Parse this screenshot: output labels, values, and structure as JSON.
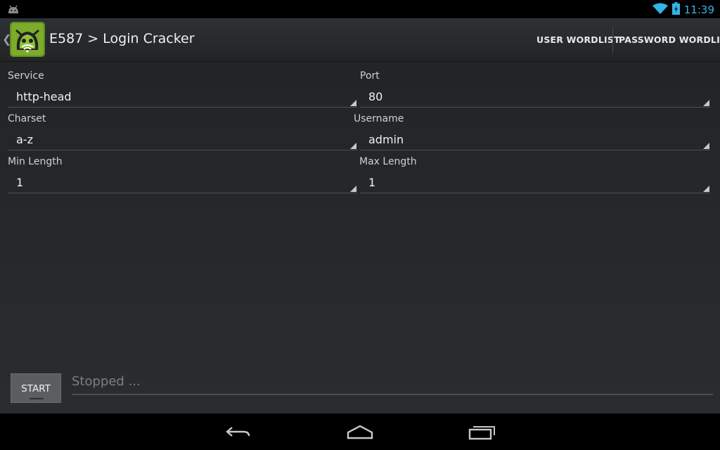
{
  "status_bar": {
    "time": "11:39",
    "icons": [
      "android-icon",
      "wifi-icon",
      "battery-charging-icon"
    ]
  },
  "action_bar": {
    "title": "E587 > Login Cracker",
    "actions": [
      "USER WORDLIST",
      "PASSWORD WORDLIST"
    ]
  },
  "form": {
    "service": {
      "label": "Service",
      "value": "http-head"
    },
    "port": {
      "label": "Port",
      "value": "80"
    },
    "charset": {
      "label": "Charset",
      "value": "a-z"
    },
    "username": {
      "label": "Username",
      "value": "admin"
    },
    "min_length": {
      "label": "Min Length",
      "value": "1"
    },
    "max_length": {
      "label": "Max Length",
      "value": "1"
    }
  },
  "controls": {
    "start_label": "START",
    "status_text": "Stopped ..."
  },
  "nav_bar": {
    "icons": [
      "back-icon",
      "home-icon",
      "recent-apps-icon"
    ]
  },
  "colors": {
    "accent": "#33b5e5",
    "background": "#202224",
    "app_icon_green": "#7dab2a"
  }
}
